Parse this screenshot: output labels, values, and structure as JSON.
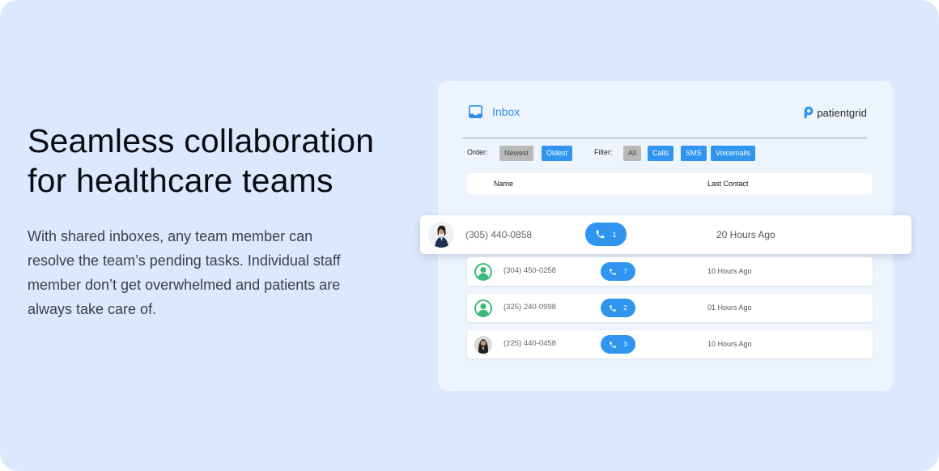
{
  "hero": {
    "headline_line1": "Seamless collaboration",
    "headline_line2": "for healthcare teams",
    "body": "With shared inboxes, any team member can resolve the team’s pending tasks. Individual staff member don’t get overwhelmed and patients are always take care of."
  },
  "inbox": {
    "title": "Inbox",
    "brand": "patientgrid",
    "order_label": "Order:",
    "order_options": [
      "Newest",
      "Oldest"
    ],
    "order_selected": "Newest",
    "filter_label": "Filter:",
    "filter_options": [
      "All",
      "Calls",
      "SMS",
      "Voicemails"
    ],
    "filter_selected": "All",
    "columns": {
      "name": "Name",
      "last_contact": "Last Contact"
    },
    "rows": [
      {
        "phone": "(305) 440-0858",
        "calls": "1",
        "last_contact": "20 Hours Ago",
        "avatar": "woman-photo-avatar",
        "highlighted": true
      },
      {
        "phone": "(304) 450-0258",
        "calls": "7",
        "last_contact": "10 Hours Ago",
        "avatar": "default-user-avatar"
      },
      {
        "phone": "(325) 240-0998",
        "calls": "2",
        "last_contact": "01 Hours Ago",
        "avatar": "default-user-avatar"
      },
      {
        "phone": "(225) 440-0458",
        "calls": "3",
        "last_contact": "10 Hours Ago",
        "avatar": "woman-photo-avatar"
      }
    ]
  },
  "colors": {
    "background": "#dce8fd",
    "card": "#eef4fe",
    "accent": "#2f95ee",
    "avatar_green": "#3cb878"
  }
}
